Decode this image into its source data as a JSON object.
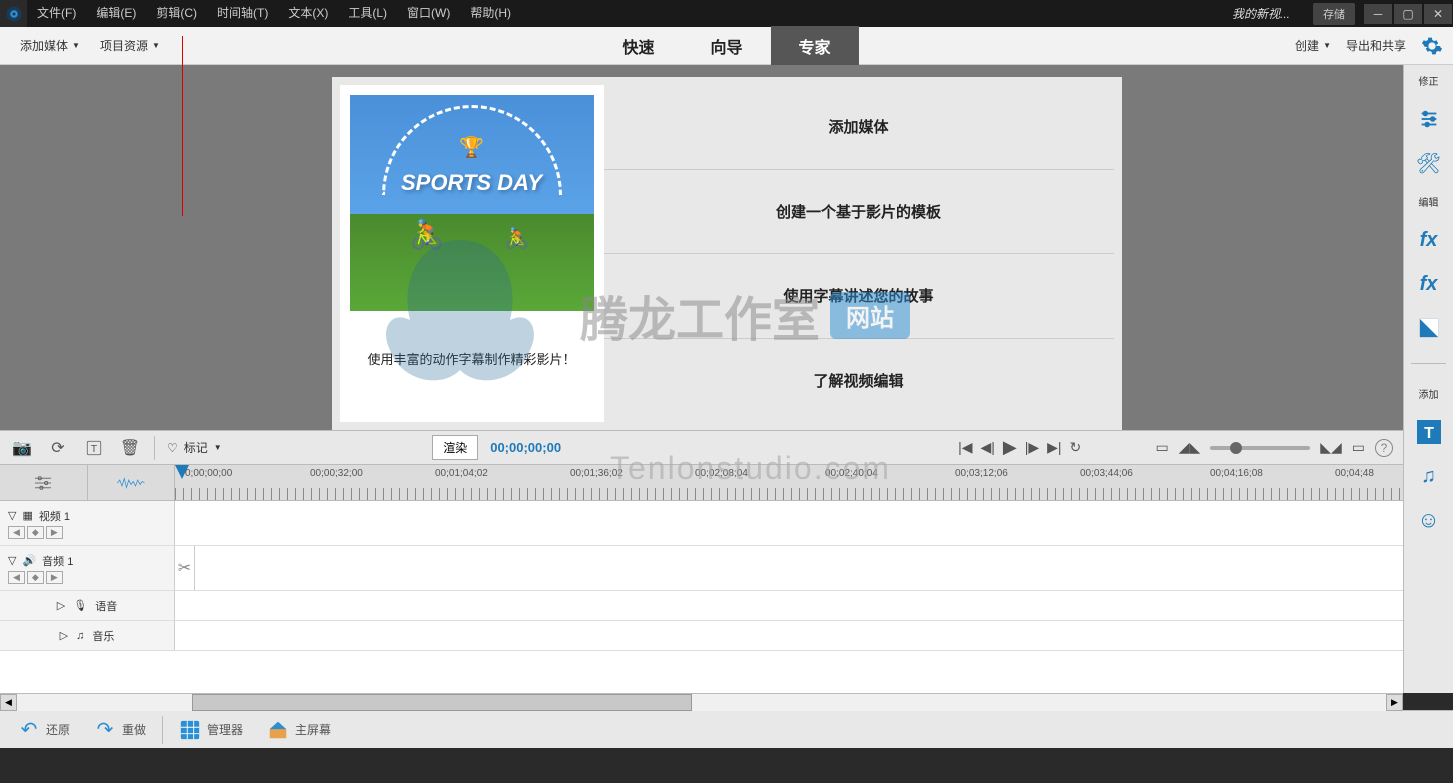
{
  "titlebar": {
    "menus": [
      "文件(F)",
      "编辑(E)",
      "剪辑(C)",
      "时间轴(T)",
      "文本(X)",
      "工具(L)",
      "窗口(W)",
      "帮助(H)"
    ],
    "project_name": "我的新视...",
    "save": "存储"
  },
  "toolbar": {
    "add_media": "添加媒体",
    "project_assets": "项目资源",
    "tabs": {
      "quick": "快速",
      "guided": "向导",
      "expert": "专家"
    },
    "create": "创建",
    "export_share": "导出和共享"
  },
  "welcome": {
    "thumb_title": "SPORTS DAY",
    "thumb_caption": "使用丰富的动作字幕制作精彩影片！",
    "options": [
      "添加媒体",
      "创建一个基于影片的模板",
      "使用字幕讲述您的故事",
      "了解视频编辑"
    ]
  },
  "side_panel": {
    "correct": "修正",
    "adjust": "",
    "tools": "",
    "edit": "编辑",
    "fx_draw": "",
    "fx": "",
    "color": "",
    "add": "添加"
  },
  "timeline_toolbar": {
    "marker": "标记",
    "render": "渲染",
    "timecode": "00;00;00;00"
  },
  "ruler_ticks": [
    "0;00;00;00",
    "00;00;32;00",
    "00;01;04;02",
    "00;01;36;02",
    "00;02;08;04",
    "00;02;40;04",
    "00;03;12;06",
    "00;03;44;06",
    "00;04;16;08",
    "00;04;48"
  ],
  "tracks": {
    "video1": "视频 1",
    "audio1": "音频 1",
    "voice": "语音",
    "music": "音乐"
  },
  "bottom_bar": {
    "undo": "还原",
    "redo": "重做",
    "manager": "管理器",
    "home": "主屏幕"
  },
  "watermark": {
    "text": "腾龙工作室",
    "badge": "网站",
    "url": "Tenlonstudio.com"
  }
}
